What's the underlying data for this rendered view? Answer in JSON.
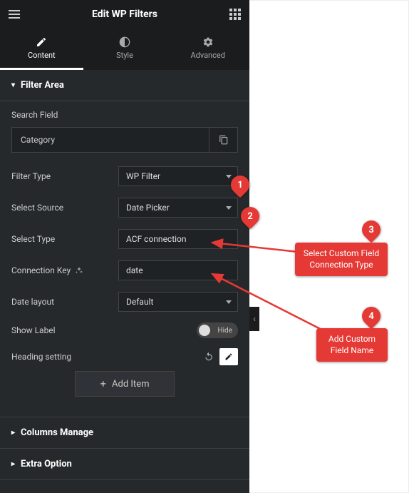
{
  "header": {
    "title": "Edit WP Filters"
  },
  "tabs": {
    "content": "Content",
    "style": "Style",
    "advanced": "Advanced"
  },
  "sections": {
    "filter_area": {
      "title": "Filter Area"
    },
    "columns_manage": {
      "title": "Columns Manage"
    },
    "extra_option": {
      "title": "Extra Option"
    }
  },
  "filter_area": {
    "search_field_label": "Search Field",
    "category_label": "Category",
    "filter_type": {
      "label": "Filter Type",
      "value": "WP Filter"
    },
    "select_source": {
      "label": "Select Source",
      "value": "Date Picker"
    },
    "select_type": {
      "label": "Select Type",
      "value": "ACF connection"
    },
    "connection_key": {
      "label": "Connection Key",
      "value": "date"
    },
    "date_layout": {
      "label": "Date layout",
      "value": "Default"
    },
    "show_label": {
      "label": "Show Label",
      "state": "Hide"
    },
    "heading_setting": {
      "label": "Heading setting"
    },
    "add_item": "Add Item"
  },
  "annotations": {
    "m1": "1",
    "m2": "2",
    "m3": "3",
    "m4": "4",
    "callout3": "Select Custom Field\nConnection Type",
    "callout4": "Add Custom\nField Name"
  },
  "colors": {
    "accent": "#e53935"
  }
}
